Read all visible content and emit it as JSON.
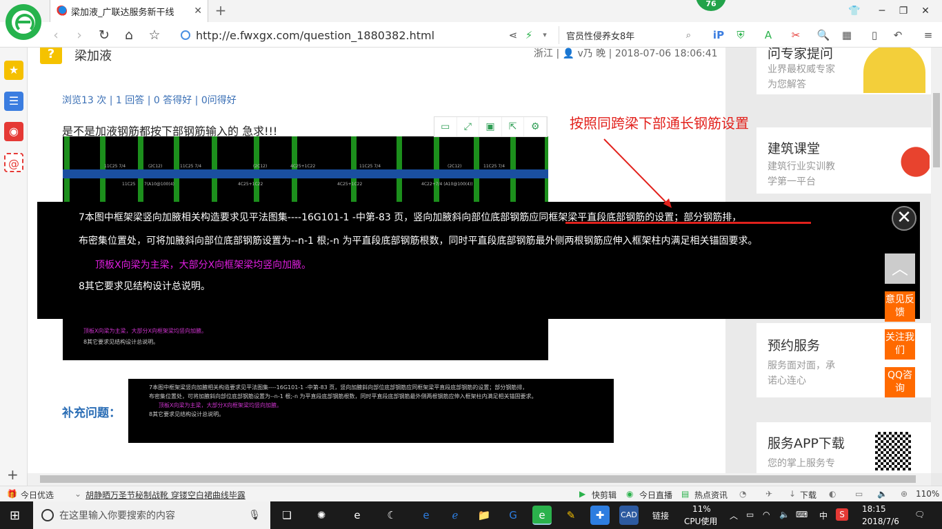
{
  "browser": {
    "tab_title": "梁加液_广联达服务新干线",
    "badge": "76",
    "url": "http://e.fwxgx.com/question_1880382.html",
    "search_text": "官员性侵养女8年"
  },
  "question": {
    "title": "梁加液",
    "meta": "浙江 | 👤 v乃 晚 | 2018-07-06 18:06:41",
    "stats": "浏览13 次 | 1 回答 | 0 答得好 | 0问得好",
    "body": "是不是加液钢筋都按下部钢筋输入的   急求!!!",
    "supplement_label": "补充问题："
  },
  "annotation": {
    "text": "按照同跨梁下部通长钢筋设置"
  },
  "lightbox": {
    "line1": "7本图中框架梁竖向加腋相关构造要求见平法图集----16G101-1  -中第-83 页，竖向加腋斜向部位底部钢筋应同框架梁平直段底部钢筋的设置；部分钢筋排，",
    "line2": "布密集位置处，可将加腋斜向部位底部钢筋设置为--n-1 根;-n    为平直段底部钢筋根数，同时平直段底部钢筋最外侧两根钢筋应伸入框架柱内满足相关锚固要求。",
    "line3": "顶板X向梁为主梁，大部分X向框架梁均竖向加腋。",
    "line4": "8其它要求见结构设计总说明。"
  },
  "cad_small": {
    "line1": "7本图中框架梁竖向加腋相关构造要求见平法图集----16G101-1  -中第-83 页，竖向加腋斜向部位底部钢筋应同框架梁平直段底部钢筋的设置；部分钢筋排，",
    "line2": "布密集位置处，可将加腋斜向部位底部钢筋设置为--n-1 根;-n    为平直段底部钢筋根数，同时平直段底部钢筋最外侧两根钢筋应伸入框架柱内满足相关锚固要求。",
    "line3": "顶板X向梁为主梁，大部分X向框架梁均竖向加腋。",
    "line4": "8其它要求见结构设计总说明。"
  },
  "cad_labels": [
    "11C25 7/4",
    "(2C12)",
    "11C25 7/4",
    "(2C12)",
    "4C25+1C22",
    "11C25 7/4",
    "(2C12)",
    "11C25 7/4"
  ],
  "cad_labels2": [
    "11C25",
    "7(A10@100(4)",
    "4C25+1C22",
    "4C25+1C22",
    "4C22+7/4 (A10@100(4))"
  ],
  "right_cards": [
    {
      "title": "问专家提问",
      "sub1": "业界最权威专家",
      "sub2": "为您解答"
    },
    {
      "title": "建筑课堂",
      "sub1": "建筑行业实训教",
      "sub2": "学第一平台"
    },
    {
      "title": "预约服务",
      "sub1": "服务面对面，承",
      "sub2": "诺心连心"
    },
    {
      "title": "服务APP下载",
      "sub1": "您的掌上服务专",
      "sub2": ""
    }
  ],
  "float_buttons": {
    "feedback": "意见反馈",
    "follow": "关注我们",
    "qq": "QQ咨询"
  },
  "status": {
    "today_pick": "今日优选",
    "news": "胡静晒万圣节秘制战靴 穿镂空白裙曲线毕露",
    "quick_cut": "快剪辑",
    "live": "今日直播",
    "hot": "热点资讯",
    "download": "下载",
    "zoom": "110%"
  },
  "taskbar": {
    "search_placeholder": "在这里输入你要搜索的内容",
    "link": "链接",
    "cpu_pct": "11%",
    "cpu_label": "CPU使用",
    "lang": "中",
    "time": "18:15",
    "date": "2018/7/6"
  },
  "colors": {
    "brand_green": "#26b34d",
    "link_blue": "#3a6fb5",
    "annot_red": "#e2211c",
    "float_orange": "#ff6a00",
    "magenta": "#e01ee0"
  }
}
